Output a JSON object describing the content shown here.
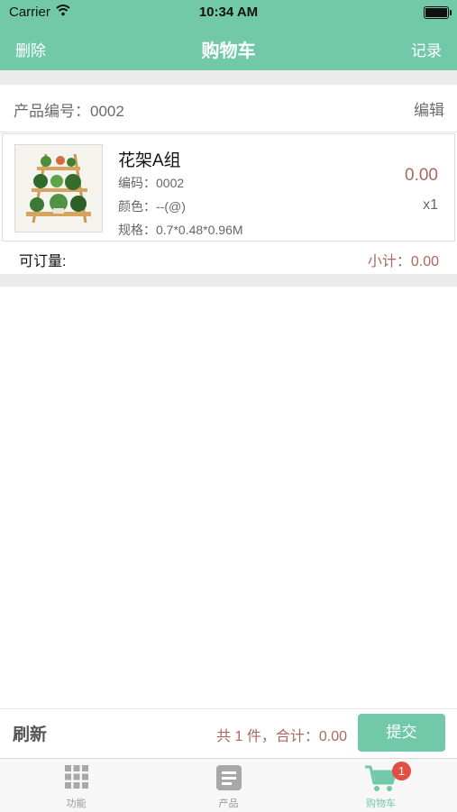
{
  "status_bar": {
    "carrier": "Carrier",
    "time": "10:34 AM"
  },
  "nav": {
    "left": "删除",
    "title": "购物车",
    "right": "记录"
  },
  "product_header": {
    "code_label": "产品编号：0002",
    "edit": "编辑"
  },
  "item": {
    "name": "花架A组",
    "code": "编码：0002",
    "color": "颜色：--(@)",
    "spec": "规格：0.7*0.48*0.96M",
    "price": "0.00",
    "qty": "x1"
  },
  "order_row": {
    "label": "可订量:",
    "subtotal": "小计：0.00"
  },
  "bottom_bar": {
    "refresh": "刷新",
    "total": "共 1 件，合计：0.00",
    "submit": "提交"
  },
  "tabs": [
    {
      "label": "功能",
      "icon": "grid-icon"
    },
    {
      "label": "产品",
      "icon": "document-icon"
    },
    {
      "label": "购物车",
      "icon": "cart-icon",
      "badge": "1"
    }
  ],
  "colors": {
    "accent": "#71c9a9",
    "price": "#a86a5c",
    "badge": "#e24d44"
  }
}
